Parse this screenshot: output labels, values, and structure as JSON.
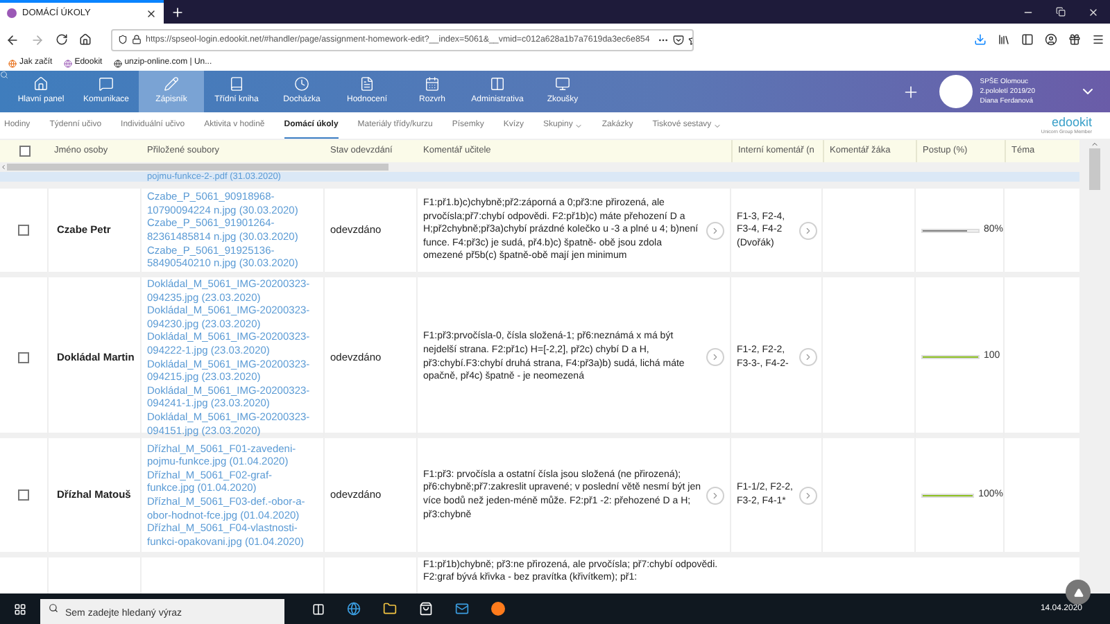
{
  "browser": {
    "tab": {
      "title": "DOMÁCÍ ÚKOLY",
      "selected": true
    },
    "url": "https://spseol-login.edookit.net/#handler/page/assignment-homework-edit?__index=5061&__vmid=c012a628a1b7a7619da3ec6e854",
    "bookmarks": [
      "Jak začít",
      "Edookit",
      "unzip-online.com | Un..."
    ]
  },
  "app": {
    "nav": [
      {
        "label": "Hlavní panel",
        "selected": false
      },
      {
        "label": "Komunikace",
        "selected": false
      },
      {
        "label": "Zápisník",
        "selected": true
      },
      {
        "label": "Třídní kniha",
        "selected": false
      },
      {
        "label": "Docházka",
        "selected": false
      },
      {
        "label": "Hodnocení",
        "selected": false
      },
      {
        "label": "Rozvrh",
        "selected": false
      },
      {
        "label": "Administrativa",
        "selected": false
      },
      {
        "label": "Zkoušky",
        "selected": false
      }
    ],
    "school": "SPŠE Olomouc",
    "term": "2.pololetí 2019/20",
    "user": "Diana Ferdanová",
    "subnav": [
      {
        "label": "Hodiny",
        "selected": false,
        "dropdown": false
      },
      {
        "label": "Týdenní učivo",
        "selected": false,
        "dropdown": false
      },
      {
        "label": "Individuální učivo",
        "selected": false,
        "dropdown": false
      },
      {
        "label": "Aktivita v hodině",
        "selected": false,
        "dropdown": false
      },
      {
        "label": "Domácí úkoly",
        "selected": true,
        "dropdown": false
      },
      {
        "label": "Materiály třídy/kurzu",
        "selected": false,
        "dropdown": false
      },
      {
        "label": "Písemky",
        "selected": false,
        "dropdown": false
      },
      {
        "label": "Kvízy",
        "selected": false,
        "dropdown": false
      },
      {
        "label": "Skupiny",
        "selected": false,
        "dropdown": true
      },
      {
        "label": "Zakázky",
        "selected": false,
        "dropdown": false
      },
      {
        "label": "Tiskové sestavy",
        "selected": false,
        "dropdown": true
      }
    ],
    "logo": {
      "name": "edookit",
      "tagline": "Unicorn Group Member"
    }
  },
  "table": {
    "select_all": {
      "checked": false
    },
    "columns": [
      "Jméno osoby",
      "Přiložené soubory",
      "Stav odevzdání",
      "Komentář učitele",
      "Interní komentář (n",
      "Komentář žáka",
      "Postup (%)",
      "Téma"
    ],
    "partial_row": {
      "files": [
        "pojmu-funkce-2-.pdf (31.03.2020)"
      ]
    },
    "rows": [
      {
        "checked": false,
        "name": "Czabe Petr",
        "files": [
          "Czabe_P_5061_90918968-10790094224 n.jpg (30.03.2020)",
          "Czabe_P_5061_91901264-82361485814 n.jpg (30.03.2020)",
          "Czabe_P_5061_91925136-58490540210 n.jpg (30.03.2020)"
        ],
        "status": "odevzdáno",
        "comment": "F1:př1.b)c)chybně;př2:záporná a 0;př3:ne přirozená, ale prvočísla;př7:chybí odpovědi. F2:př1b)c) máte přehození D a H;př2chybně;př3a)chybí prázdné kolečko u -3 a plné u 4; b)není funce. F4:př3c) je sudá, př4.b)c) špatně- obě jsou zdola omezené př5b(c) špatně-obě mají jen minimum",
        "internal": "F1-3, F2-4, F3-4, F4-2 (Dvořák)",
        "progress": {
          "level": 0.8,
          "color": "#808080",
          "label": "80%"
        }
      },
      {
        "checked": false,
        "name": "Dokládal Martin",
        "files": [
          "Dokládal_M_5061_IMG-20200323-094235.jpg (23.03.2020)",
          "Dokládal_M_5061_IMG-20200323-094230.jpg (23.03.2020)",
          "Dokládal_M_5061_IMG-20200323-094222-1.jpg (23.03.2020)",
          "Dokládal_M_5061_IMG-20200323-094215.jpg (23.03.2020)",
          "Dokládal_M_5061_IMG-20200323-094241-1.jpg (23.03.2020)",
          "Dokládal_M_5061_IMG-20200323-094151.jpg (23.03.2020)"
        ],
        "status": "odevzdáno",
        "comment": "F1:př3:prvočísla-0, čísla složená-1; př6:neznámá x má být nejdelší strana. F2:př1c) H=[-2,2], př2c) chybí D a H, př3:chybí.F3:chybí druhá strana, F4:př3a)b) sudá, lichá máte opačně, př4c) špatně - je neomezená",
        "internal": "F1-2, F2-2, F3-3-, F4-2-",
        "progress": {
          "level": 1,
          "color": "#8cbf1f",
          "label": "100"
        }
      },
      {
        "checked": false,
        "name": "Dřízhal Matouš",
        "files": [
          "Dřízhal_M_5061_F01-zavedeni-pojmu-funkce.jpg (01.04.2020)",
          "Dřízhal_M_5061_F02-graf-funkce.jpg (01.04.2020)",
          "Dřízhal_M_5061_F03-def.-obor-a-obor-hodnot-fce.jpg (01.04.2020)",
          "Dřízhal_M_5061_F04-vlastnosti-funkci-opakovani.jpg (01.04.2020)"
        ],
        "status": "odevzdáno",
        "comment": "F1:př3: prvočísla a ostatní čísla jsou složená (ne přirozená); př6:chybně;př7:zakreslit upravené; v poslední větě nesmí být jen více bodů než jeden-méně může. F2:př1 -2: přehozené D a H; př3:chybně",
        "internal": "F1-1/2, F2-2, F3-2, F4-1*",
        "progress": {
          "level": 1,
          "color": "#8cbf1f",
          "label": "100%"
        }
      }
    ],
    "cut_row": {
      "comment": "F1:př1b)chybně; př3:ne přirozená, ale prvočísla; př7:chybí odpovědi. F2:graf bývá křivka - bez pravítka (křivítkem); př1:"
    }
  },
  "taskbar": {
    "search_placeholder": "Sem zadejte hledaný výraz",
    "date": "14.04.2020"
  }
}
